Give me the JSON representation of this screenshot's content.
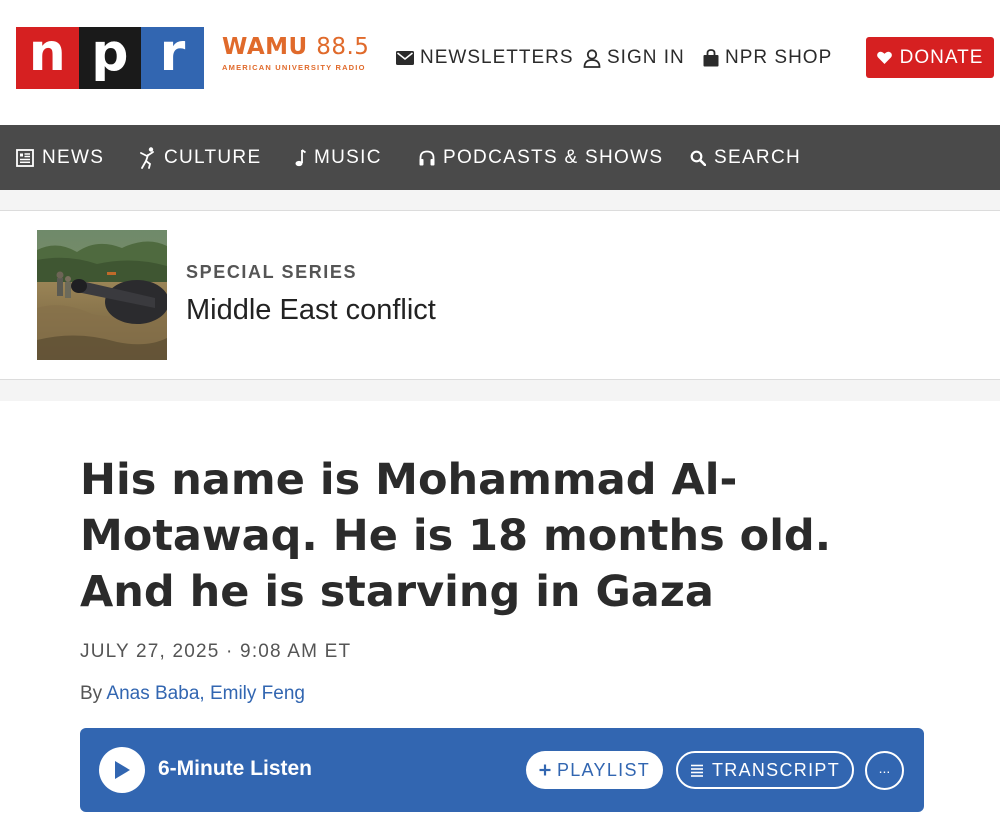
{
  "header": {
    "logo": {
      "letters": [
        "n",
        "p",
        "r"
      ]
    },
    "station": {
      "name": "WAMU",
      "frequency": "88.5",
      "subtitle": "AMERICAN UNIVERSITY RADIO"
    },
    "links": [
      {
        "label": "NEWSLETTERS",
        "icon": "mail-icon"
      },
      {
        "label": "SIGN IN",
        "icon": "user-icon"
      },
      {
        "label": "NPR SHOP",
        "icon": "shopping-bag-icon"
      }
    ],
    "donate": {
      "label": "DONATE",
      "icon": "heart-icon"
    }
  },
  "nav": {
    "items": [
      {
        "label": "NEWS",
        "icon": "newspaper-icon"
      },
      {
        "label": "CULTURE",
        "icon": "dancer-icon"
      },
      {
        "label": "MUSIC",
        "icon": "music-note-icon"
      },
      {
        "label": "PODCASTS & SHOWS",
        "icon": "headphones-icon"
      },
      {
        "label": "SEARCH",
        "icon": "search-icon"
      }
    ]
  },
  "series": {
    "kicker": "SPECIAL SERIES",
    "title": "Middle East conflict"
  },
  "story": {
    "headline": "His name is Mohammad Al-Motawaq. He is 18 months old. And he is starving in Gaza",
    "date": "JULY 27, 2025",
    "separator": "·",
    "time": "9:08 AM ET",
    "by_prefix": "By",
    "authors": [
      "Anas Baba",
      "Emily Feng"
    ],
    "author_separator": ","
  },
  "player": {
    "listen_label": "6-Minute Listen",
    "playlist_label": "PLAYLIST",
    "transcript_label": "TRANSCRIPT",
    "more_label": "...",
    "colors": {
      "background": "#3266b1",
      "pill_text": "#3266b1"
    }
  },
  "colors": {
    "npr_red": "#d62021",
    "npr_black": "#1a1a1a",
    "npr_blue": "#3266b1",
    "wamu_orange": "#e06a2b",
    "nav_background": "#4a4a4a",
    "link_blue": "#3266b1"
  }
}
